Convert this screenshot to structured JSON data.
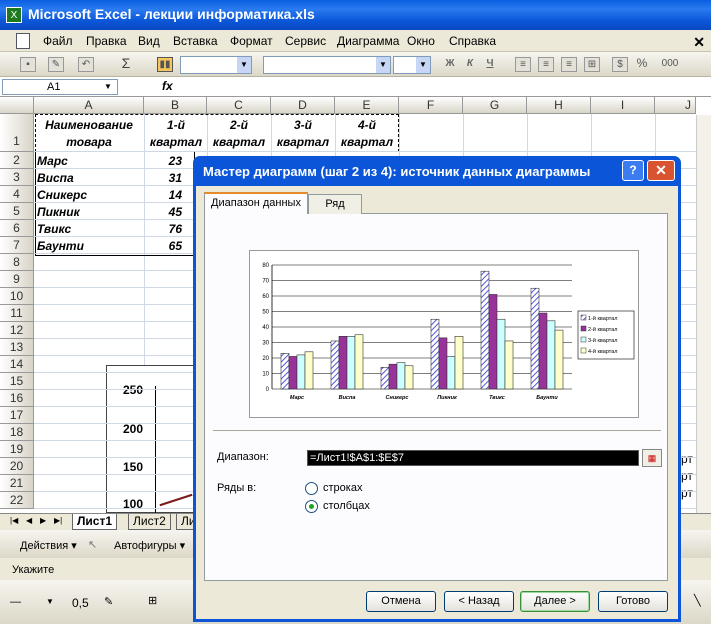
{
  "window": {
    "title": "Microsoft Excel - лекции информатика.xls",
    "icon": "excel-icon"
  },
  "menu": [
    "Файл",
    "Правка",
    "Вид",
    "Вставка",
    "Формат",
    "Сервис",
    "Диаграмма",
    "Окно",
    "Справка"
  ],
  "toolbar": {
    "sigma": "Σ",
    "bold": "Ж",
    "italic": "К",
    "underline": "Ч",
    "percent": "%",
    "thousands": "000"
  },
  "formula_bar": {
    "cell_ref": "A1",
    "fx": "fx"
  },
  "columns": [
    "A",
    "B",
    "C",
    "D",
    "E",
    "F",
    "G",
    "H",
    "I",
    "J"
  ],
  "rows": [
    "1",
    "2",
    "3",
    "4",
    "5",
    "6",
    "7",
    "8",
    "9",
    "10",
    "11",
    "12",
    "13",
    "14",
    "15",
    "16",
    "17",
    "18",
    "19",
    "20",
    "21",
    "22"
  ],
  "table": {
    "header": {
      "name_line1": "Наименование",
      "name_line2": "товара",
      "q1_1": "1-й",
      "q1_2": "квартал",
      "q2_1": "2-й",
      "q2_2": "квартал",
      "q3_1": "3-й",
      "q3_2": "квартал",
      "q4_1": "4-й",
      "q4_2": "квартал"
    },
    "rows": [
      {
        "name": "Марс",
        "q1": "23"
      },
      {
        "name": "Виспа",
        "q1": "31"
      },
      {
        "name": "Сникерс",
        "q1": "14"
      },
      {
        "name": "Пикник",
        "q1": "45"
      },
      {
        "name": "Твикс",
        "q1": "76"
      },
      {
        "name": "Баунти",
        "q1": "65"
      }
    ]
  },
  "embedded_chart": {
    "yticks": [
      "250",
      "200",
      "150",
      "100"
    ]
  },
  "right_overflow": {
    "r20": "рт",
    "r21": "рт",
    "r22": "рт"
  },
  "sheets": [
    "Лист1",
    "Лист2",
    "Ли"
  ],
  "drawing": {
    "actions": "Действия ▾",
    "autoshapes": "Автофигуры ▾"
  },
  "status": "Укажите",
  "format_bar": {
    "line_width": "0,5"
  },
  "dialog": {
    "title": "Мастер диаграмм (шаг 2 из 4): источник данных диаграммы",
    "help": "?",
    "tabs": [
      "Диапазон данных",
      "Ряд"
    ],
    "range_label": "Диапазон:",
    "range_value": "=Лист1!$A$1:$E$7",
    "series_label": "Ряды в:",
    "radio_rows": "строках",
    "radio_cols": "столбцах",
    "buttons": {
      "cancel": "Отмена",
      "back": "< Назад",
      "next": "Далее >",
      "finish": "Готово"
    }
  },
  "chart_data": {
    "type": "bar",
    "categories": [
      "Марс",
      "Виспа",
      "Сникерс",
      "Пикник",
      "Твикс",
      "Баунти"
    ],
    "series": [
      {
        "name": "1-й квартал",
        "values": [
          23,
          31,
          14,
          45,
          76,
          65
        ],
        "color": "#9999ff",
        "pattern": "hatch"
      },
      {
        "name": "2-й квартал",
        "values": [
          21,
          34,
          16,
          33,
          61,
          49
        ],
        "color": "#993399"
      },
      {
        "name": "3-й квартал",
        "values": [
          22,
          34,
          17,
          21,
          45,
          44
        ],
        "color": "#ccffff"
      },
      {
        "name": "4-й квартал",
        "values": [
          24,
          35,
          15,
          34,
          31,
          38
        ],
        "color": "#ffffcc"
      }
    ],
    "ylim": [
      0,
      80
    ],
    "yticks": [
      0,
      10,
      20,
      30,
      40,
      50,
      60,
      70,
      80
    ],
    "grid": true,
    "legend": "right"
  }
}
